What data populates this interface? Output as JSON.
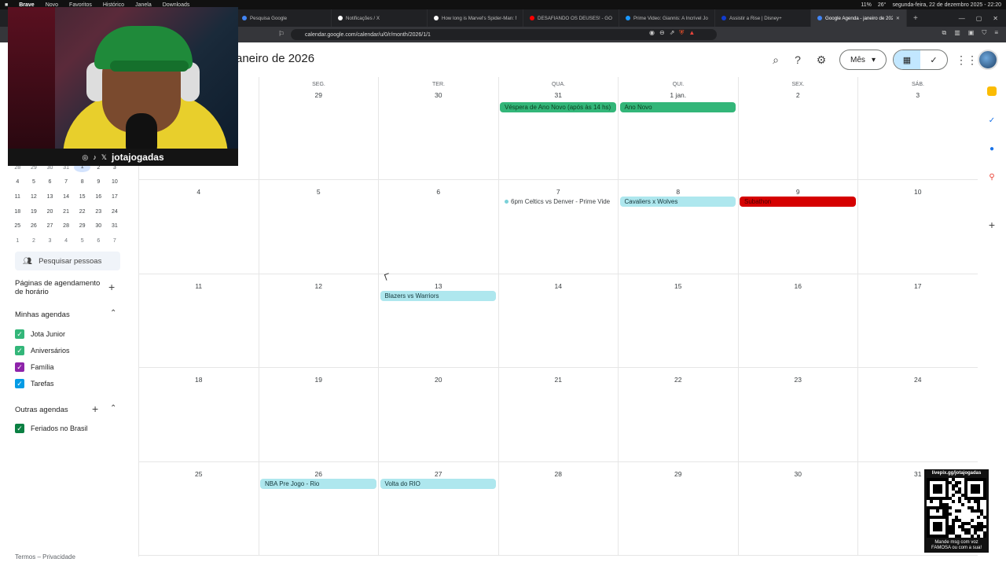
{
  "menubar": {
    "items": [
      "Brave",
      "Novo",
      "Favoritos",
      "Histórico",
      "Janela",
      "Downloads"
    ],
    "status": "11%",
    "temp": "26°",
    "datetime": "segunda-feira, 22 de dezembro 2025 - 22:20"
  },
  "tabs": [
    {
      "label": "Pesquisa Google",
      "color": "#4285f4",
      "active": false
    },
    {
      "label": "Notificações / X",
      "color": "#ffffff",
      "active": false
    },
    {
      "label": "How long is Marvel's Spider-Man: M",
      "color": "#ffffff",
      "active": false
    },
    {
      "label": "DESAFIANDO OS DEUSES! - GOD O",
      "color": "#ff0000",
      "active": false
    },
    {
      "label": "Prime Video: Giannis: A Incrível Jorn",
      "color": "#1a98ff",
      "active": false
    },
    {
      "label": "Assistir a Rise | Disney+",
      "color": "#113ccf",
      "active": false
    },
    {
      "label": "Google Agenda - janeiro de 202",
      "color": "#4285f4",
      "active": true
    }
  ],
  "url": "calendar.google.com/calendar/u/0/r/month/2026/1/1",
  "header": {
    "title": "aneiro de 2026",
    "view_label": "Mês"
  },
  "webcam": {
    "name": "jotajogadas"
  },
  "minical": {
    "rows": [
      [
        {
          "d": "28",
          "o": true
        },
        {
          "d": "29",
          "o": true
        },
        {
          "d": "30",
          "o": true
        },
        {
          "d": "31",
          "o": true
        },
        {
          "d": "1",
          "o": false,
          "s": true
        },
        {
          "d": "2",
          "o": false
        },
        {
          "d": "3",
          "o": false
        }
      ],
      [
        {
          "d": "4"
        },
        {
          "d": "5"
        },
        {
          "d": "6"
        },
        {
          "d": "7"
        },
        {
          "d": "8"
        },
        {
          "d": "9"
        },
        {
          "d": "10"
        }
      ],
      [
        {
          "d": "11"
        },
        {
          "d": "12"
        },
        {
          "d": "13"
        },
        {
          "d": "14"
        },
        {
          "d": "15"
        },
        {
          "d": "16"
        },
        {
          "d": "17"
        }
      ],
      [
        {
          "d": "18"
        },
        {
          "d": "19"
        },
        {
          "d": "20"
        },
        {
          "d": "21"
        },
        {
          "d": "22"
        },
        {
          "d": "23"
        },
        {
          "d": "24"
        }
      ],
      [
        {
          "d": "25"
        },
        {
          "d": "26"
        },
        {
          "d": "27"
        },
        {
          "d": "28"
        },
        {
          "d": "29"
        },
        {
          "d": "30"
        },
        {
          "d": "31"
        }
      ],
      [
        {
          "d": "1",
          "o": true
        },
        {
          "d": "2",
          "o": true
        },
        {
          "d": "3",
          "o": true
        },
        {
          "d": "4",
          "o": true
        },
        {
          "d": "5",
          "o": true
        },
        {
          "d": "6",
          "o": true
        },
        {
          "d": "7",
          "o": true
        }
      ]
    ]
  },
  "sidebar": {
    "people_search": "Pesquisar pessoas",
    "booking_pages": "Páginas de agendamento de horário",
    "my_calendars": "Minhas agendas",
    "calendars": [
      {
        "name": "Jota Junior",
        "color": "#33b679"
      },
      {
        "name": "Aniversários",
        "color": "#33b679"
      },
      {
        "name": "Família",
        "color": "#8e24aa"
      },
      {
        "name": "Tarefas",
        "color": "#039be5"
      }
    ],
    "other_calendars": "Outras agendas",
    "others": [
      {
        "name": "Feriados no Brasil",
        "color": "#0b8043"
      }
    ],
    "footer": "Termos – Privacidade"
  },
  "weekdays": [
    "",
    "SEG.",
    "TER.",
    "QUA.",
    "QUI.",
    "SEX.",
    "SÁB."
  ],
  "weeks": [
    [
      "",
      "29",
      "30",
      "31",
      "1 jan.",
      "2",
      "3"
    ],
    [
      "4",
      "5",
      "6",
      "7",
      "8",
      "9",
      "10"
    ],
    [
      "11",
      "12",
      "13",
      "14",
      "15",
      "16",
      "17"
    ],
    [
      "18",
      "19",
      "20",
      "21",
      "22",
      "23",
      "24"
    ],
    [
      "25",
      "26",
      "27",
      "28",
      "29",
      "30",
      "31"
    ]
  ],
  "events": [
    {
      "week": 0,
      "col": 3,
      "label": "Véspera de Ano Novo (após às 14 hs)",
      "style": "green"
    },
    {
      "week": 0,
      "col": 4,
      "label": "Ano Novo",
      "style": "green"
    },
    {
      "week": 1,
      "col": 3,
      "label": "6pm Celtics vs Denver - Prime Vide",
      "style": "dot"
    },
    {
      "week": 1,
      "col": 4,
      "label": "Cavaliers x Wolves",
      "style": "teal"
    },
    {
      "week": 1,
      "col": 5,
      "label": "Subathon",
      "style": "red"
    },
    {
      "week": 2,
      "col": 2,
      "label": "Blazers vs Warriors",
      "style": "teal"
    },
    {
      "week": 4,
      "col": 1,
      "label": "NBA Pre Jogo - Rio",
      "style": "teal"
    },
    {
      "week": 4,
      "col": 2,
      "label": "Volta do RIO",
      "style": "teal"
    }
  ],
  "qr": {
    "url": "livepix.gg/jotajogadas",
    "message": "Mande msg com voz FAMOSA ou com a sua!"
  }
}
